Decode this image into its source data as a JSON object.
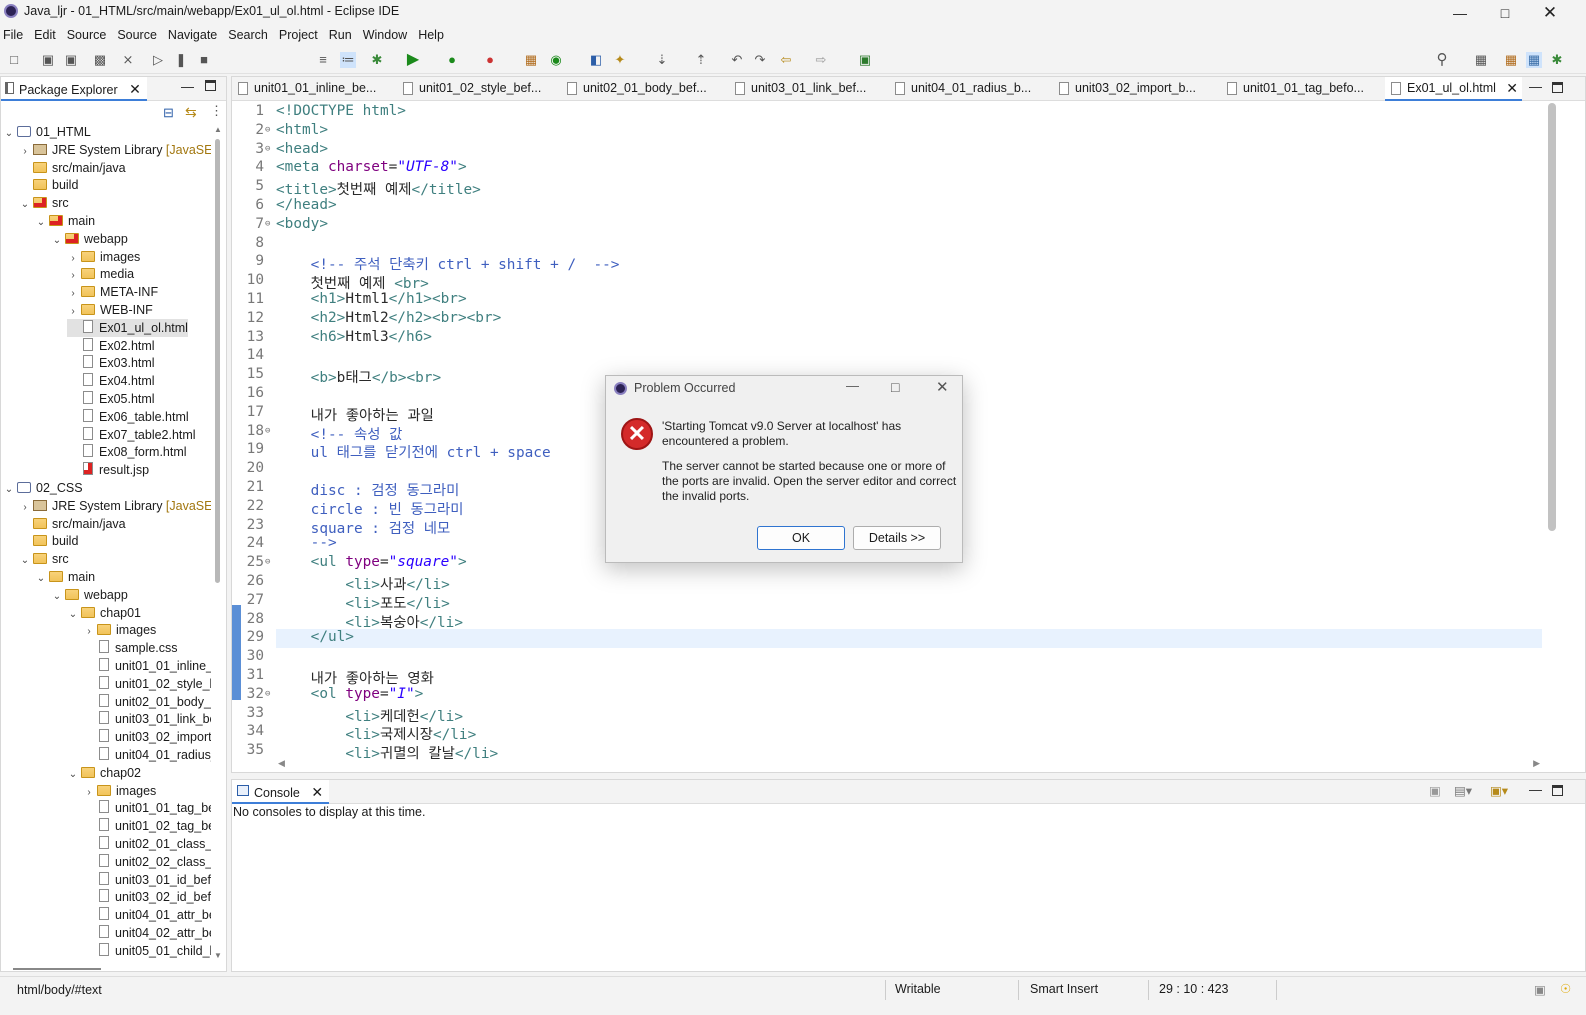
{
  "window": {
    "title": "Java_ljr - 01_HTML/src/main/webapp/Ex01_ul_ol.html - Eclipse IDE",
    "min_icon": "minimize-icon",
    "max_icon": "maximize-icon",
    "close_icon": "close-icon"
  },
  "menu": [
    "File",
    "Edit",
    "Source",
    "Source",
    "Navigate",
    "Search",
    "Project",
    "Run",
    "Window",
    "Help"
  ],
  "package_explorer": {
    "title": "Package Explorer",
    "tree": [
      {
        "label": "01_HTML",
        "twisty": "⌄",
        "icon": "proj"
      },
      {
        "label": "JRE System Library",
        "suffix": "[JavaSE-17",
        "twisty": "›",
        "icon": "lib"
      },
      {
        "label": "src/main/java",
        "twisty": "",
        "icon": "folder"
      },
      {
        "label": "build",
        "twisty": "",
        "icon": "folder"
      },
      {
        "label": "src",
        "twisty": "⌄",
        "icon": "folder err"
      },
      {
        "label": "main",
        "twisty": "⌄",
        "icon": "folder err"
      },
      {
        "label": "webapp",
        "twisty": "⌄",
        "icon": "folder err"
      },
      {
        "label": "images",
        "twisty": "›",
        "icon": "folder"
      },
      {
        "label": "media",
        "twisty": "›",
        "icon": "folder"
      },
      {
        "label": "META-INF",
        "twisty": "›",
        "icon": "folder"
      },
      {
        "label": "WEB-INF",
        "twisty": "›",
        "icon": "folder"
      },
      {
        "label": "Ex01_ul_ol.html",
        "twisty": "",
        "icon": "file"
      },
      {
        "label": "Ex02.html",
        "twisty": "",
        "icon": "file"
      },
      {
        "label": "Ex03.html",
        "twisty": "",
        "icon": "file"
      },
      {
        "label": "Ex04.html",
        "twisty": "",
        "icon": "file"
      },
      {
        "label": "Ex05.html",
        "twisty": "",
        "icon": "file"
      },
      {
        "label": "Ex06_table.html",
        "twisty": "",
        "icon": "file"
      },
      {
        "label": "Ex07_table2.html",
        "twisty": "",
        "icon": "file"
      },
      {
        "label": "Ex08_form.html",
        "twisty": "",
        "icon": "file"
      },
      {
        "label": "result.jsp",
        "twisty": "",
        "icon": "file err"
      },
      {
        "label": "02_CSS",
        "twisty": "⌄",
        "icon": "proj"
      },
      {
        "label": "JRE System Library",
        "suffix": "[JavaSE-17",
        "twisty": "›",
        "icon": "lib"
      },
      {
        "label": "src/main/java",
        "twisty": "",
        "icon": "folder"
      },
      {
        "label": "build",
        "twisty": "",
        "icon": "folder"
      },
      {
        "label": "src",
        "twisty": "⌄",
        "icon": "folder"
      },
      {
        "label": "main",
        "twisty": "⌄",
        "icon": "folder"
      },
      {
        "label": "webapp",
        "twisty": "⌄",
        "icon": "folder"
      },
      {
        "label": "chap01",
        "twisty": "⌄",
        "icon": "folder"
      },
      {
        "label": "images",
        "twisty": "›",
        "icon": "folder"
      },
      {
        "label": "sample.css",
        "twisty": "",
        "icon": "file"
      },
      {
        "label": "unit01_01_inline_l",
        "twisty": "",
        "icon": "file"
      },
      {
        "label": "unit01_02_style_b",
        "twisty": "",
        "icon": "file"
      },
      {
        "label": "unit02_01_body_b",
        "twisty": "",
        "icon": "file"
      },
      {
        "label": "unit03_01_link_be",
        "twisty": "",
        "icon": "file"
      },
      {
        "label": "unit03_02_import",
        "twisty": "",
        "icon": "file"
      },
      {
        "label": "unit04_01_radius_",
        "twisty": "",
        "icon": "file"
      },
      {
        "label": "chap02",
        "twisty": "⌄",
        "icon": "folder"
      },
      {
        "label": "images",
        "twisty": "›",
        "icon": "folder"
      },
      {
        "label": "unit01_01_tag_be",
        "twisty": "",
        "icon": "file"
      },
      {
        "label": "unit01_02_tag_be",
        "twisty": "",
        "icon": "file"
      },
      {
        "label": "unit02_01_class_b",
        "twisty": "",
        "icon": "file"
      },
      {
        "label": "unit02_02_class_b",
        "twisty": "",
        "icon": "file"
      },
      {
        "label": "unit03_01_id_befc",
        "twisty": "",
        "icon": "file"
      },
      {
        "label": "unit03_02_id_befc",
        "twisty": "",
        "icon": "file"
      },
      {
        "label": "unit04_01_attr_be",
        "twisty": "",
        "icon": "file"
      },
      {
        "label": "unit04_02_attr_be",
        "twisty": "",
        "icon": "file"
      },
      {
        "label": "unit05_01_child_b",
        "twisty": "",
        "icon": "file"
      }
    ]
  },
  "editor_tabs": [
    "unit01_01_inline_be...",
    "unit01_02_style_bef...",
    "unit02_01_body_bef...",
    "unit03_01_link_bef...",
    "unit04_01_radius_b...",
    "unit03_02_import_b...",
    "unit01_01_tag_befo...",
    "Ex01_ul_ol.html"
  ],
  "code_lines": [
    [
      [
        "tg",
        "<!DOCTYPE html>"
      ]
    ],
    [
      [
        "tg",
        "<html>"
      ]
    ],
    [
      [
        "tg",
        "<head>"
      ]
    ],
    [
      [
        "tg",
        "<meta "
      ],
      [
        "at",
        "charset"
      ],
      [
        "tx",
        "="
      ],
      [
        "av",
        "\"UTF-8\""
      ],
      [
        "tg",
        ">"
      ]
    ],
    [
      [
        "tg",
        "<title>"
      ],
      [
        "tx",
        "첫번째 예제"
      ],
      [
        "tg",
        "</title>"
      ]
    ],
    [
      [
        "tg",
        "</head>"
      ]
    ],
    [
      [
        "tg",
        "<body>"
      ]
    ],
    [],
    [
      [
        "tx",
        "    "
      ],
      [
        "cm",
        "<!-- 주석 단축키 ctrl + shift + /  -->"
      ]
    ],
    [
      [
        "tx",
        "    첫번째 예제 "
      ],
      [
        "tg",
        "<br>"
      ]
    ],
    [
      [
        "tx",
        "    "
      ],
      [
        "tg",
        "<h1>"
      ],
      [
        "tx",
        "Html1"
      ],
      [
        "tg",
        "</h1><br>"
      ]
    ],
    [
      [
        "tx",
        "    "
      ],
      [
        "tg",
        "<h2>"
      ],
      [
        "tx",
        "Html2"
      ],
      [
        "tg",
        "</h2><br><br>"
      ]
    ],
    [
      [
        "tx",
        "    "
      ],
      [
        "tg",
        "<h6>"
      ],
      [
        "tx",
        "Html3"
      ],
      [
        "tg",
        "</h6>"
      ]
    ],
    [],
    [
      [
        "tx",
        "    "
      ],
      [
        "tg",
        "<b>"
      ],
      [
        "tx",
        "b태그"
      ],
      [
        "tg",
        "</b><br>"
      ]
    ],
    [],
    [
      [
        "tx",
        "    내가 좋아하는 과일"
      ]
    ],
    [
      [
        "tx",
        "    "
      ],
      [
        "cm",
        "<!-- 속성 값"
      ]
    ],
    [
      [
        "cm",
        "    ul 태그를 닫기전에 ctrl + space"
      ]
    ],
    [],
    [
      [
        "cm",
        "    disc : 검정 동그라미"
      ]
    ],
    [
      [
        "cm",
        "    circle : 빈 동그라미"
      ]
    ],
    [
      [
        "cm",
        "    square : 검정 네모"
      ]
    ],
    [
      [
        "cm",
        "    -->"
      ]
    ],
    [
      [
        "tx",
        "    "
      ],
      [
        "tg",
        "<ul "
      ],
      [
        "at",
        "type"
      ],
      [
        "tx",
        "="
      ],
      [
        "av",
        "\"square\""
      ],
      [
        "tg",
        ">"
      ]
    ],
    [
      [
        "tx",
        "        "
      ],
      [
        "tg",
        "<li>"
      ],
      [
        "tx",
        "사과"
      ],
      [
        "tg",
        "</li>"
      ]
    ],
    [
      [
        "tx",
        "        "
      ],
      [
        "tg",
        "<li>"
      ],
      [
        "tx",
        "포도"
      ],
      [
        "tg",
        "</li>"
      ]
    ],
    [
      [
        "tx",
        "        "
      ],
      [
        "tg",
        "<li>"
      ],
      [
        "tx",
        "복숭아"
      ],
      [
        "tg",
        "</li>"
      ]
    ],
    [
      [
        "tx",
        "    "
      ],
      [
        "tg",
        "</ul>"
      ]
    ],
    [],
    [
      [
        "tx",
        "    내가 좋아하는 영화"
      ]
    ],
    [
      [
        "tx",
        "    "
      ],
      [
        "tg",
        "<ol "
      ],
      [
        "at",
        "type"
      ],
      [
        "tx",
        "="
      ],
      [
        "av",
        "\"I\""
      ],
      [
        "tg",
        ">"
      ]
    ],
    [
      [
        "tx",
        "        "
      ],
      [
        "tg",
        "<li>"
      ],
      [
        "tx",
        "케데헌"
      ],
      [
        "tg",
        "</li>"
      ]
    ],
    [
      [
        "tx",
        "        "
      ],
      [
        "tg",
        "<li>"
      ],
      [
        "tx",
        "국제시장"
      ],
      [
        "tg",
        "</li>"
      ]
    ],
    [
      [
        "tx",
        "        "
      ],
      [
        "tg",
        "<li>"
      ],
      [
        "tx",
        "귀멸의 칼날"
      ],
      [
        "tg",
        "</li>"
      ]
    ]
  ],
  "fold_lines": [
    2,
    3,
    7,
    18,
    25,
    32
  ],
  "dialog": {
    "title": "Problem Occurred",
    "message": "'Starting Tomcat v9.0 Server at localhost' has encountered a problem.",
    "detail": "The server cannot be started because one or more of the ports are invalid. Open the server editor and correct the invalid ports.",
    "ok": "OK",
    "details": "Details >>"
  },
  "console": {
    "title": "Console",
    "empty": "No consoles to display at this time."
  },
  "status": {
    "path": "html/body/#text",
    "writable": "Writable",
    "insert": "Smart Insert",
    "position": "29 : 10 : 423"
  }
}
